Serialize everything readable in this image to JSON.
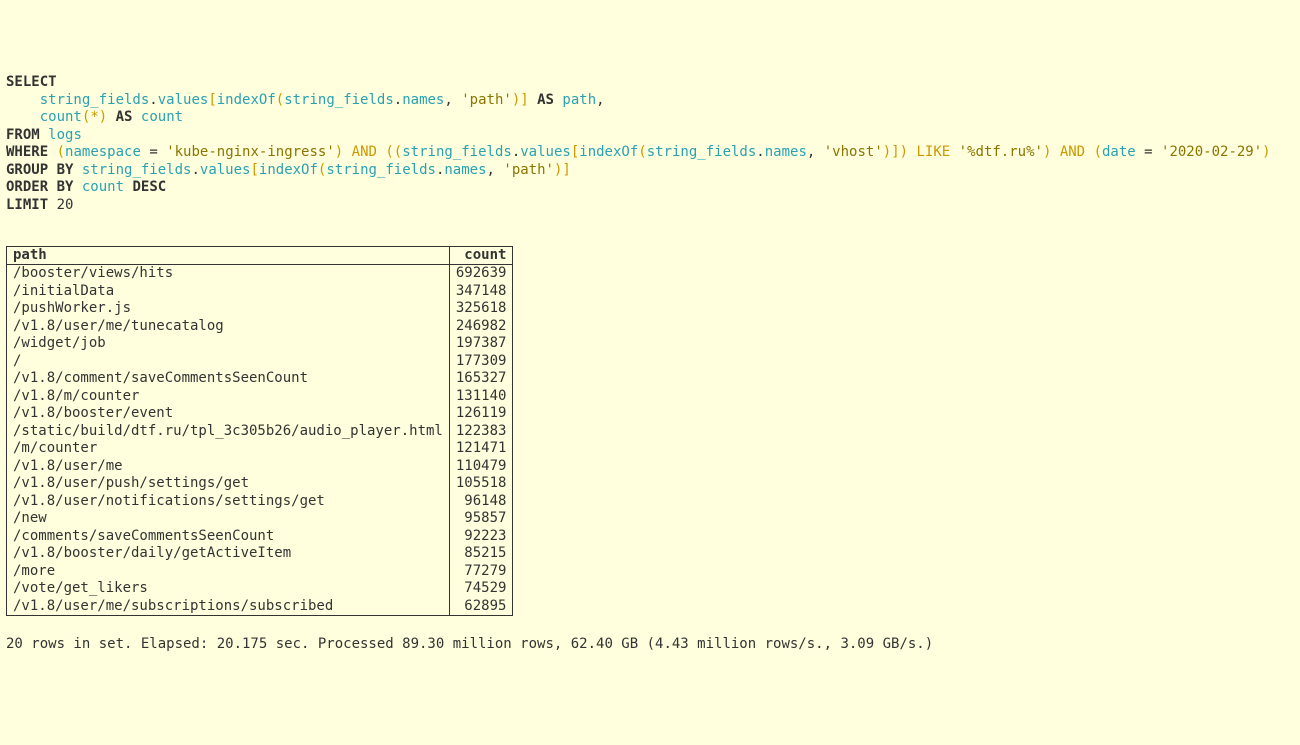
{
  "sql": {
    "kw_select": "SELECT",
    "kw_as1": "AS",
    "kw_as2": "AS",
    "kw_from": "FROM",
    "kw_where": "WHERE",
    "kw_groupby": "GROUP BY",
    "kw_orderby": "ORDER BY",
    "kw_desc": "DESC",
    "kw_limit": "LIMIT",
    "op_and1": "AND",
    "op_and2": "AND",
    "op_like": "LIKE",
    "id_string_fields": "string_fields",
    "id_values": "values",
    "id_names": "names",
    "id_namespace": "namespace",
    "id_date": "date",
    "id_logs": "logs",
    "id_indexOf": "indexOf",
    "id_count_fn": "count",
    "id_count_alias": "count",
    "id_path_alias": "path",
    "str_path": "'path'",
    "str_vhost": "'vhost'",
    "str_ns": "'kube-nginx-ingress'",
    "str_like": "'%dtf.ru%'",
    "str_date": "'2020-02-29'",
    "limit_n": "20"
  },
  "table": {
    "headers": {
      "path": "path",
      "count": "count"
    },
    "rows": [
      {
        "path": "/booster/views/hits",
        "count": "692639"
      },
      {
        "path": "/initialData",
        "count": "347148"
      },
      {
        "path": "/pushWorker.js",
        "count": "325618"
      },
      {
        "path": "/v1.8/user/me/tunecatalog",
        "count": "246982"
      },
      {
        "path": "/widget/job",
        "count": "197387"
      },
      {
        "path": "/",
        "count": "177309"
      },
      {
        "path": "/v1.8/comment/saveCommentsSeenCount",
        "count": "165327"
      },
      {
        "path": "/v1.8/m/counter",
        "count": "131140"
      },
      {
        "path": "/v1.8/booster/event",
        "count": "126119"
      },
      {
        "path": "/static/build/dtf.ru/tpl_3c305b26/audio_player.html",
        "count": "122383"
      },
      {
        "path": "/m/counter",
        "count": "121471"
      },
      {
        "path": "/v1.8/user/me",
        "count": "110479"
      },
      {
        "path": "/v1.8/user/push/settings/get",
        "count": "105518"
      },
      {
        "path": "/v1.8/user/notifications/settings/get",
        "count": "96148"
      },
      {
        "path": "/new",
        "count": "95857"
      },
      {
        "path": "/comments/saveCommentsSeenCount",
        "count": "92223"
      },
      {
        "path": "/v1.8/booster/daily/getActiveItem",
        "count": "85215"
      },
      {
        "path": "/more",
        "count": "77279"
      },
      {
        "path": "/vote/get_likers",
        "count": "74529"
      },
      {
        "path": "/v1.8/user/me/subscriptions/subscribed",
        "count": "62895"
      }
    ]
  },
  "status": "20 rows in set. Elapsed: 20.175 sec. Processed 89.30 million rows, 62.40 GB (4.43 million rows/s., 3.09 GB/s.)"
}
